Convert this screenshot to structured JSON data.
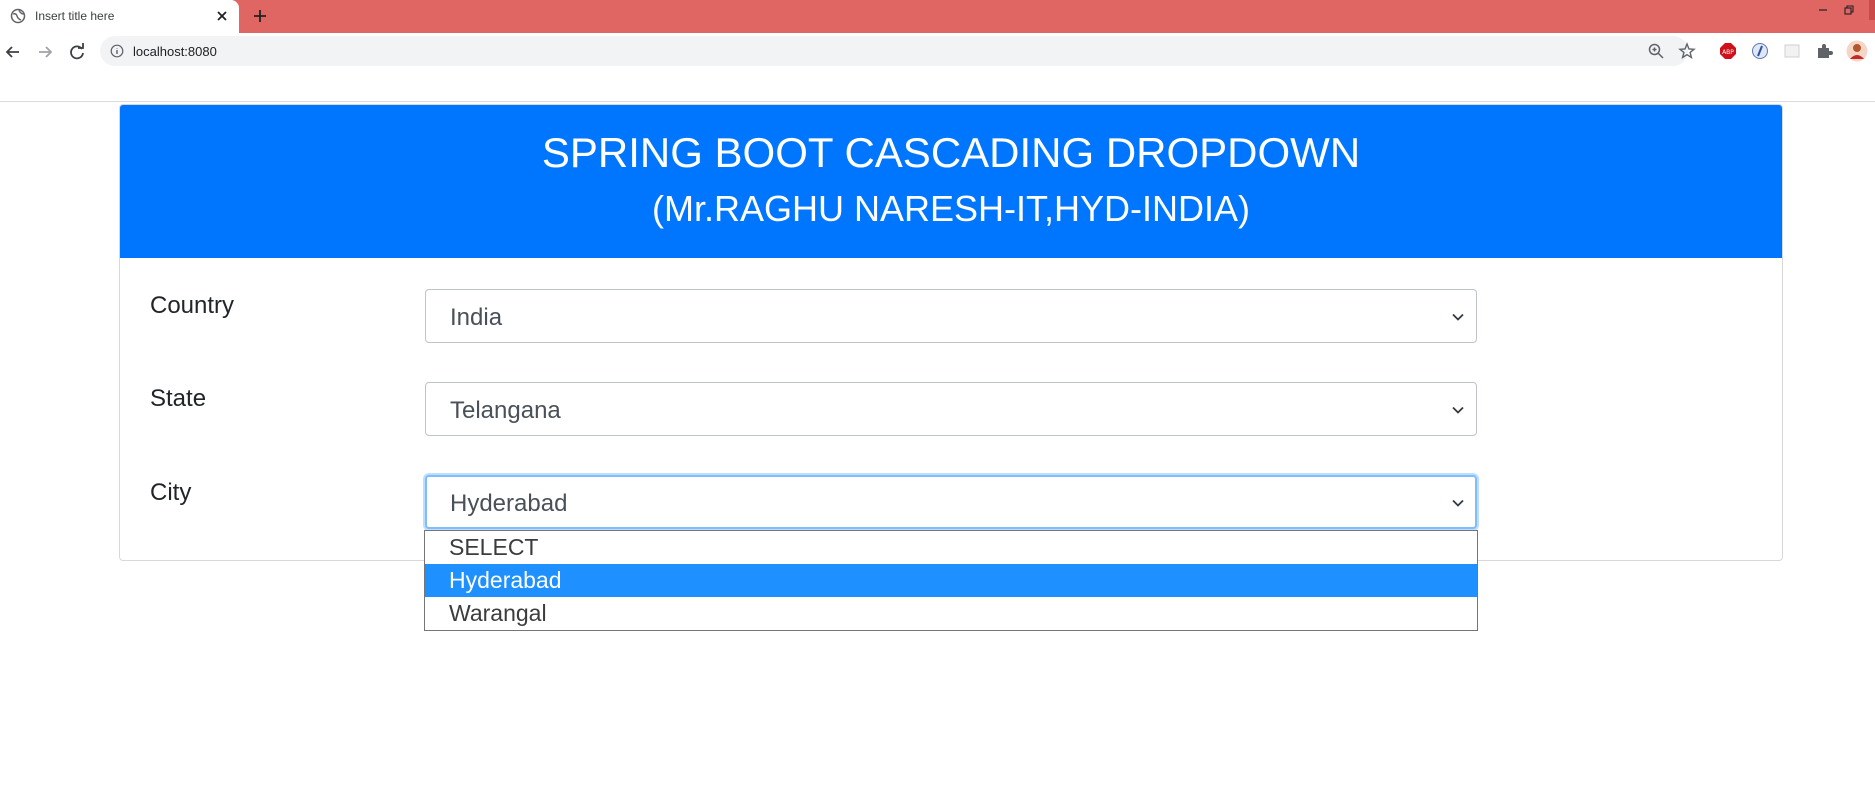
{
  "browser": {
    "tab_title": "Insert title here",
    "url": "localhost:8080"
  },
  "header": {
    "title": "SPRING BOOT CASCADING DROPDOWN",
    "subtitle": "(Mr.RAGHU NARESH-IT,HYD-INDIA)"
  },
  "form": {
    "country": {
      "label": "Country",
      "value": "India"
    },
    "state": {
      "label": "State",
      "value": "Telangana"
    },
    "city": {
      "label": "City",
      "value": "Hyderabad"
    }
  },
  "city_dropdown": {
    "options": [
      "SELECT",
      "Hyderabad",
      "Warangal"
    ],
    "selected": "Hyderabad"
  },
  "colors": {
    "tabstrip": "#e06664",
    "header_bg": "#0076fe",
    "option_highlight": "#1e90ff"
  }
}
